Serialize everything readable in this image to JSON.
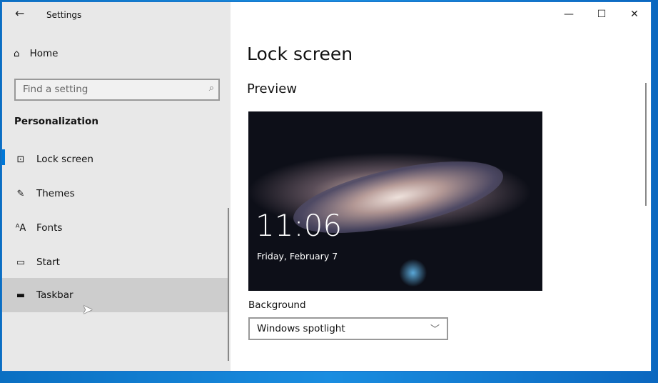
{
  "window": {
    "title": "Settings",
    "controls": {
      "minimize": "—",
      "maximize": "☐",
      "close": "✕"
    }
  },
  "sidebar": {
    "home": "Home",
    "search_placeholder": "Find a setting",
    "section": "Personalization",
    "items": [
      {
        "label": "Lock screen",
        "icon": "lock-screen-icon",
        "glyph": "⊡",
        "selected": true
      },
      {
        "label": "Themes",
        "icon": "themes-icon",
        "glyph": "✎"
      },
      {
        "label": "Fonts",
        "icon": "fonts-icon",
        "glyph": "ᴬA"
      },
      {
        "label": "Start",
        "icon": "start-icon",
        "glyph": "▭"
      },
      {
        "label": "Taskbar",
        "icon": "taskbar-icon",
        "glyph": "▬",
        "hovered": true
      }
    ]
  },
  "main": {
    "title": "Lock screen",
    "preview_heading": "Preview",
    "preview": {
      "time": "11:06",
      "date": "Friday, February 7"
    },
    "background_label": "Background",
    "background_value": "Windows spotlight"
  },
  "colors": {
    "accent": "#0078d7"
  }
}
